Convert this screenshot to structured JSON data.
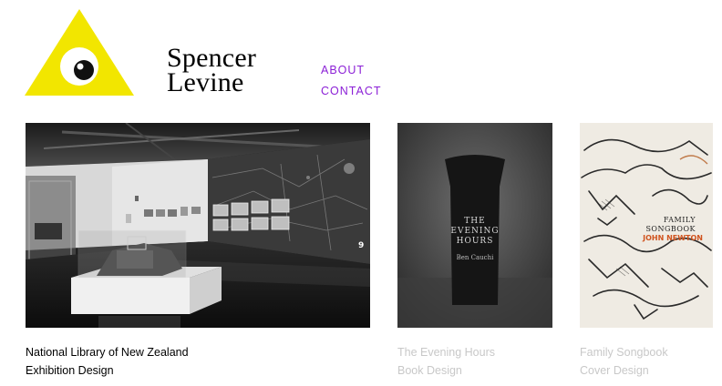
{
  "brand": {
    "line1": "Spencer",
    "line2": "Levine",
    "logo_icon": "eye-triangle-icon",
    "logo_color": "#f2e600"
  },
  "nav": {
    "items": [
      "ABOUT",
      "CONTACT"
    ],
    "color": "#8b1fd6"
  },
  "projects": [
    {
      "title": "National Library of New Zealand",
      "subtitle": "Exhibition Design",
      "state": "active"
    },
    {
      "title": "The Evening Hours",
      "subtitle": "Book Design",
      "state": "muted",
      "cover_title_1": "THE",
      "cover_title_2": "EVENING",
      "cover_title_3": "HOURS",
      "cover_author": "Ben Cauchi"
    },
    {
      "title": "Family Songbook",
      "subtitle": "Cover Design",
      "state": "muted",
      "cover_title_1": "FAMILY",
      "cover_title_2": "SONGBOOK",
      "cover_author": "JOHN NEWTON"
    }
  ],
  "colors": {
    "caption_active": "#000000",
    "caption_muted": "#c8c8c8"
  }
}
